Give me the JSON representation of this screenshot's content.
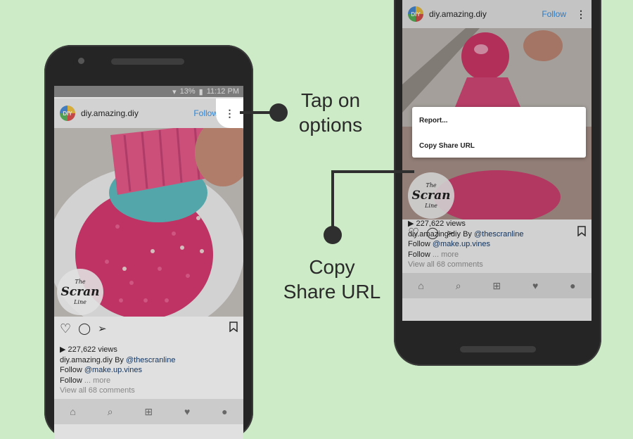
{
  "status_bar": {
    "battery": "13%",
    "time": "11:12 PM"
  },
  "post": {
    "logo_text": "DIY",
    "username": "diy.amazing.diy",
    "follow_label": "Follow",
    "more_icon": "vertical-ellipsis-icon",
    "watermark_lines": [
      "The",
      "Scran",
      "Line"
    ],
    "views": "227,622 views",
    "caption_user": "diy.amazing.diy",
    "caption_by": "By",
    "caption_mention": "@thescranline",
    "caption_follow": "Follow",
    "caption_mention2": "@make.up.vines",
    "caption_follow2": "Follow",
    "caption_more": "... more",
    "comments_link": "View all 68 comments"
  },
  "menu": {
    "report": "Report...",
    "copy_share_url": "Copy Share URL"
  },
  "callouts": {
    "tap_options": [
      "Tap on",
      "options"
    ],
    "copy_url": [
      "Copy",
      "Share URL"
    ]
  },
  "colors": {
    "background": "#cdebc6",
    "accent": "#3897f0",
    "phone": "#252525"
  }
}
